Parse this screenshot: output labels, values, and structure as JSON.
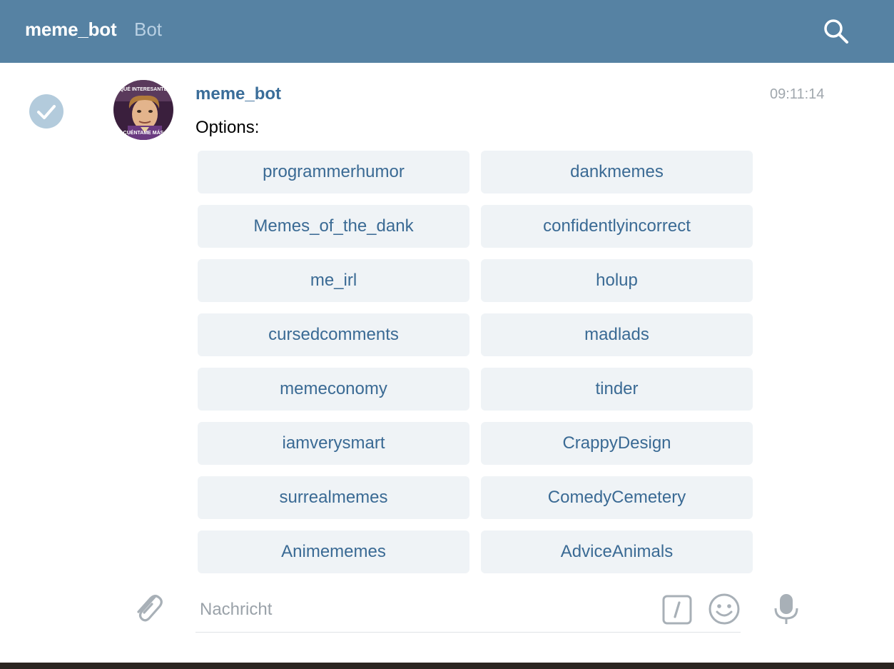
{
  "header": {
    "title": "meme_bot",
    "subtitle": "Bot"
  },
  "message": {
    "sender": "meme_bot",
    "time": "09:11:14",
    "text": "Options:",
    "avatar_caption_top": "QUÉ INTERESANTE",
    "avatar_caption_bottom": "CUÉNTAME MÁS"
  },
  "keyboard": [
    "programmerhumor",
    "dankmemes",
    "Memes_of_the_dank",
    "confidentlyincorrect",
    "me_irl",
    "holup",
    "cursedcomments",
    "madlads",
    "memeconomy",
    "tinder",
    "iamverysmart",
    "CrappyDesign",
    "surrealmemes",
    "ComedyCemetery",
    "Animememes",
    "AdviceAnimals"
  ],
  "composer": {
    "placeholder": "Nachricht"
  },
  "colors": {
    "header_bg": "#5682a3",
    "button_bg": "#eff3f6",
    "button_text": "#3a6a94",
    "sender": "#3a6d99"
  },
  "icons": [
    "search-icon",
    "checkmark-icon",
    "paperclip-icon",
    "slash-command-icon",
    "emoji-icon",
    "microphone-icon"
  ]
}
